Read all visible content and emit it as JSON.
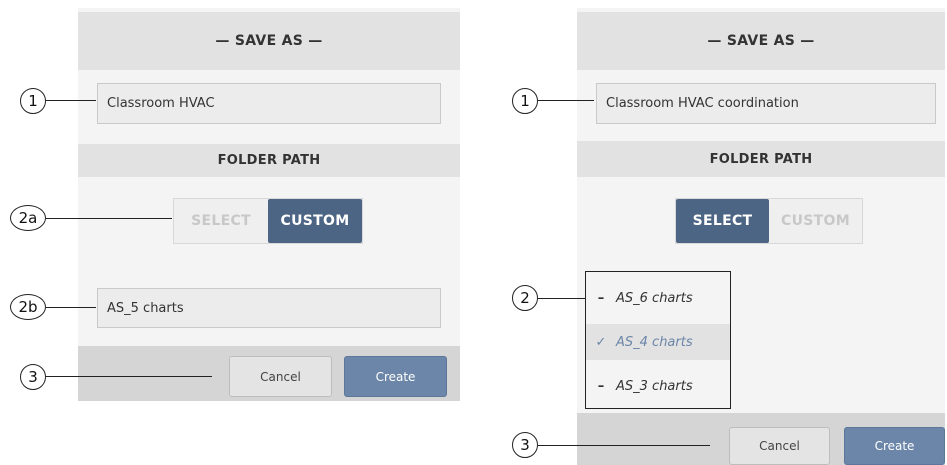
{
  "left": {
    "title": "— SAVE AS —",
    "name_value": "Classroom HVAC",
    "folder_path_label": "FOLDER PATH",
    "select_label": "SELECT",
    "custom_label": "CUSTOM",
    "active_mode": "custom",
    "custom_path_value": "AS_5 charts",
    "cancel_label": "Cancel",
    "create_label": "Create"
  },
  "right": {
    "title": "— SAVE AS —",
    "name_value": "Classroom HVAC coordination",
    "folder_path_label": "FOLDER PATH",
    "select_label": "SELECT",
    "custom_label": "CUSTOM",
    "active_mode": "select",
    "folders": [
      {
        "label": "AS_6 charts",
        "marker": "–",
        "selected": false
      },
      {
        "label": "AS_4 charts",
        "marker": "✓",
        "selected": true
      },
      {
        "label": "AS_3 charts",
        "marker": "–",
        "selected": false
      }
    ],
    "cancel_label": "Cancel",
    "create_label": "Create"
  },
  "callouts": {
    "left": [
      "1",
      "2a",
      "2b",
      "3"
    ],
    "right": [
      "1",
      "2",
      "3"
    ]
  },
  "colors": {
    "header_bg": "#e2e2e2",
    "active_toggle": "#4d6584",
    "create_button": "#6b86a8",
    "selected_folder_text": "#6b86a8"
  }
}
